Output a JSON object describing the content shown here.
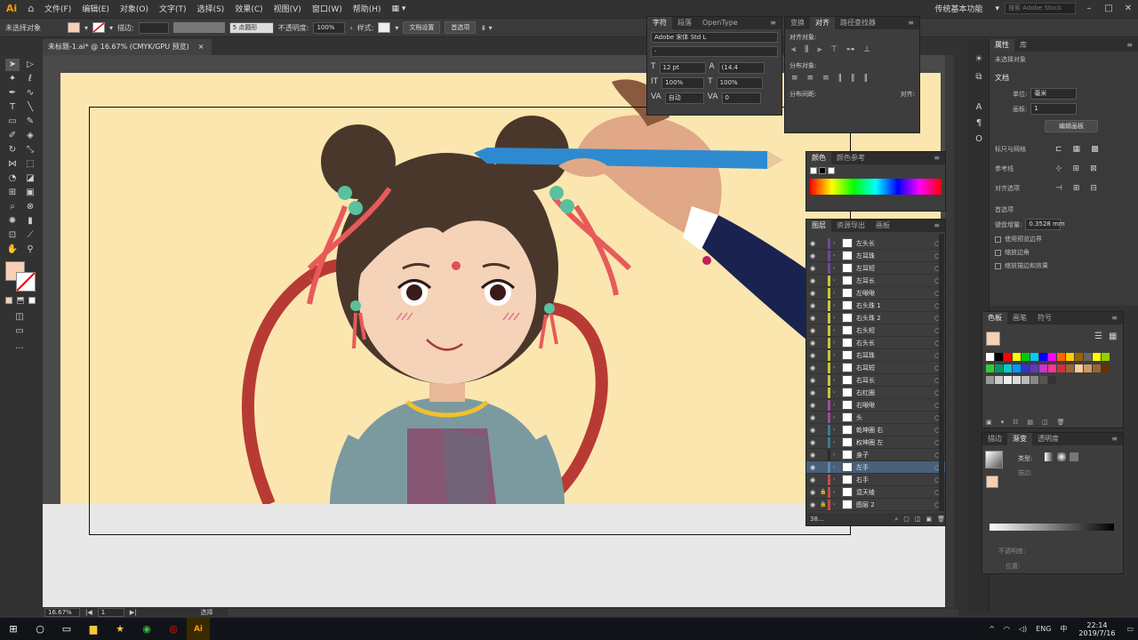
{
  "menubar": {
    "logo": "Ai",
    "items": [
      "文件(F)",
      "编辑(E)",
      "对象(O)",
      "文字(T)",
      "选择(S)",
      "效果(C)",
      "视图(V)",
      "窗口(W)",
      "帮助(H)"
    ],
    "workspace": "传统基本功能",
    "search_placeholder": "搜索 Adobe Stock"
  },
  "controlbar": {
    "no_selection": "未选择对象",
    "stroke_label": "描边:",
    "brush_value": "5 点圆形",
    "opacity_label": "不透明度:",
    "opacity_value": "100%",
    "style_label": "样式:",
    "doc_setup": "文档设置",
    "preferences": "首选项",
    "fill_color": "#f5d0b5"
  },
  "document": {
    "tab_title": "未标题-1.ai* @ 16.67% (CMYK/GPU 预览)",
    "close": "×"
  },
  "character_panel": {
    "tabs": [
      "字符",
      "段落",
      "OpenType"
    ],
    "font": "Adobe 宋体 Std L",
    "style": "-",
    "size": "12 pt",
    "leading": "(14.4",
    "vscale": "100%",
    "hscale": "100%",
    "kerning": "自动",
    "tracking": "0"
  },
  "align_panel": {
    "tabs": [
      "变换",
      "对齐",
      "路径查找器"
    ],
    "align_objects": "对齐对象:",
    "distribute_objects": "分布对象:",
    "distribute_spacing": "分布间距:",
    "align_to": "对齐:"
  },
  "color_panel": {
    "tabs": [
      "颜色",
      "颜色参考"
    ]
  },
  "layers_panel": {
    "tabs": [
      "图层",
      "资源导出",
      "画板"
    ],
    "count": "38...",
    "layers": [
      {
        "name": "左头长",
        "color": "#6a4aa0"
      },
      {
        "name": "左耳珠",
        "color": "#6a4aa0"
      },
      {
        "name": "左耳短",
        "color": "#6a4aa0"
      },
      {
        "name": "左耳长",
        "color": "#c8c83a"
      },
      {
        "name": "左啾啾",
        "color": "#c8c83a"
      },
      {
        "name": "右头珠 1",
        "color": "#c8c83a"
      },
      {
        "name": "右头珠 2",
        "color": "#c8c83a"
      },
      {
        "name": "右头短",
        "color": "#c8c83a"
      },
      {
        "name": "右头长",
        "color": "#c8c83a"
      },
      {
        "name": "右耳珠",
        "color": "#c8c83a"
      },
      {
        "name": "右耳短",
        "color": "#c8c83a"
      },
      {
        "name": "右耳长",
        "color": "#c8c83a"
      },
      {
        "name": "右红圈",
        "color": "#c8c83a"
      },
      {
        "name": "右啾啾",
        "color": "#a04aa0"
      },
      {
        "name": "头",
        "color": "#a04aa0"
      },
      {
        "name": "乾坤圈 右",
        "color": "#3a7a9a"
      },
      {
        "name": "权坤圈 左",
        "color": "#3a7a9a"
      },
      {
        "name": "身子",
        "color": "#2a2a2a"
      },
      {
        "name": "左手",
        "color": "#5a8ab0"
      },
      {
        "name": "右手",
        "color": "#c84a4a"
      },
      {
        "name": "混天绫",
        "color": "#c84a4a"
      },
      {
        "name": "图层 2",
        "color": "#c84a4a"
      }
    ],
    "selected_index": 18
  },
  "properties_panel": {
    "tabs": [
      "属性",
      "库"
    ],
    "no_selection": "未选择对象",
    "doc_section": "文档",
    "units_label": "单位:",
    "units_value": "毫米",
    "artboard_label": "画板:",
    "artboard_value": "1",
    "edit_artboards": "编辑画板",
    "rulers_grids": "标尺与网格",
    "guides": "参考线",
    "snap_options": "对齐选项",
    "preferences": "首选项",
    "keyboard_increment_label": "键盘增量:",
    "keyboard_increment_value": "0.3528 mm",
    "use_preview_bounds": "使用预览边界",
    "scale_corners": "缩放边角",
    "scale_strokes": "缩放描边和效果"
  },
  "swatches_panel": {
    "tabs": [
      "色板",
      "画笔",
      "符号"
    ]
  },
  "gradient_panel": {
    "tabs": [
      "描边",
      "渐变",
      "透明度"
    ],
    "type_label": "类型:",
    "stroke_label": "描边:",
    "opacity_label": "不透明度:",
    "position_label": "位置:"
  },
  "statusbar": {
    "zoom": "16.67%",
    "artboard": "1",
    "tool": "选择"
  },
  "taskbar": {
    "lang": "ENG",
    "time": "22:14",
    "date": "2019/7/16",
    "ai_label": "Ai"
  }
}
